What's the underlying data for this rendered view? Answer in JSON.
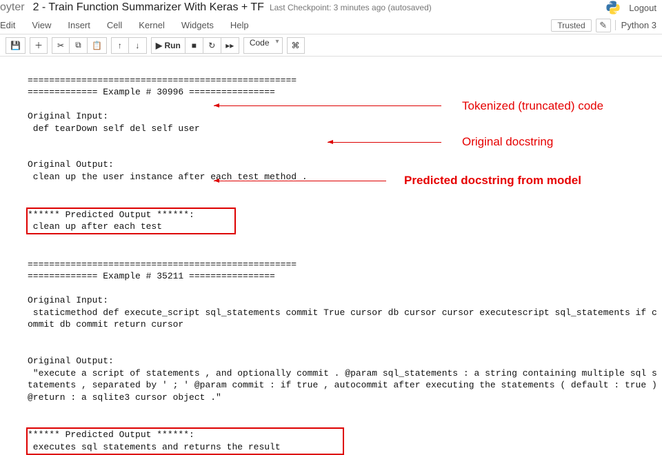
{
  "header": {
    "logo_text": "oyter",
    "title": "2 - Train Function Summarizer With Keras + TF",
    "checkpoint": "Last Checkpoint: 3 minutes ago  (autosaved)",
    "logout": "Logout"
  },
  "menubar": {
    "items": [
      "Edit",
      "View",
      "Insert",
      "Cell",
      "Kernel",
      "Widgets",
      "Help"
    ],
    "trusted": "Trusted",
    "kernel": "Python 3"
  },
  "toolbar": {
    "run_label": "▶ Run",
    "celltype": "Code"
  },
  "output": {
    "ex1": {
      "bar_top": "==================================================",
      "bar_mid": "============= Example # 30996 ================",
      "orig_in_label": "Original Input:",
      "orig_in": " def tearDown self del self user",
      "orig_out_label": "Original Output:",
      "orig_out": " clean up the user instance after each test method .",
      "pred_label": "****** Predicted Output ******:",
      "pred": " clean up after each test"
    },
    "ex2": {
      "bar_top": "==================================================",
      "bar_mid": "============= Example # 35211 ================",
      "orig_in_label": "Original Input:",
      "orig_in_l1": " staticmethod def execute_script sql_statements commit True cursor db cursor cursor executescript sql_statements if c",
      "orig_in_l2": "ommit db commit return cursor",
      "orig_out_label": "Original Output:",
      "orig_out_l1": " \"execute a script of statements , and optionally commit . @param sql_statements : a string containing multiple sql s",
      "orig_out_l2": "tatements , separated by ' ; ' @param commit : if true , autocommit after executing the statements ( default : true )",
      "orig_out_l3": "@return : a sqlite3 cursor object .\"",
      "pred_label": "****** Predicted Output ******:",
      "pred": " executes sql statements and returns the result"
    }
  },
  "annotations": {
    "tokenized": "Tokenized (truncated) code",
    "orig_doc": "Original docstring",
    "pred_doc": "Predicted docstring from model"
  },
  "colors": {
    "annotation_red": "#e60000"
  }
}
